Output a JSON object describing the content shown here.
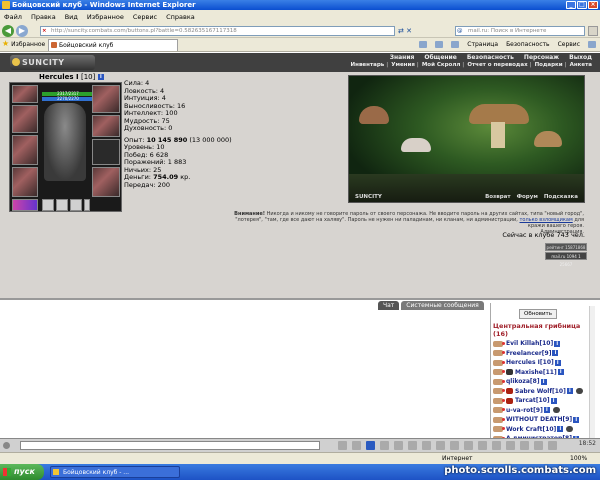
{
  "window": {
    "title": "Бойцовский клуб - Windows Internet Explorer"
  },
  "menu": [
    "Файл",
    "Правка",
    "Вид",
    "Избранное",
    "Сервис",
    "Справка"
  ],
  "address": {
    "url": "http://suncity.combats.com/buttons.pl?battle=0.582635167117318"
  },
  "search": {
    "placeholder": "mail.ru: Поиск в Интернете"
  },
  "favorites": {
    "label": "Избранное"
  },
  "tab": {
    "title": "Бойцовский клуб"
  },
  "ie_tools": [
    "Страница",
    "Безопасность",
    "Сервис"
  ],
  "game": {
    "logo": "SUNCITY",
    "nav_top": [
      "Знания",
      "Общение",
      "Безопасность",
      "Персонаж",
      "Выход"
    ],
    "nav_bottom": [
      "Инвентарь",
      "Умения",
      "Мой Скролл",
      "Отчет о переводах",
      "Подарки",
      "Анкета"
    ],
    "character": {
      "name": "Hercules I",
      "level": "[10]",
      "hp": "2317/2317",
      "mana": "2270/2270",
      "stats": [
        "Сила: 4",
        "Ловкость: 4",
        "Интуиция: 4",
        "Выносливость: 16",
        "Интеллект: 100",
        "Мудрость: 75",
        "Духовность: 0"
      ],
      "exp_label": "Опыт:",
      "exp_value": "10 145 890",
      "exp_next": "(13 000 000)",
      "details": [
        "Уровень: 10",
        "Побед: 6 628",
        "Поражений: 1 883",
        "Ничьих: 25"
      ],
      "money_label": "Деньги:",
      "money_value": "754.09",
      "money_unit": "кр.",
      "transfers": "Передач: 200"
    },
    "picture": {
      "caption": "SUNCITY",
      "links": [
        "Возврат",
        "Форум",
        "Подсказка"
      ]
    },
    "warning": {
      "bold": "Внимание!",
      "text1": "Никогда и никому не говорите пароль от своего персонажа. Не вводите пароль на других сайтах, типа \"новый город\", \"лотерея\", \"там, где все дают на халяву\". Пароль не нужен ни паладинам, ни кланам, ни администрации,",
      "link": "только взломщикам",
      "text2": "для кражи вашего героя.",
      "signature": "Администрация."
    },
    "online": "Сейчас в клубе 743 чел.",
    "counters": [
      "рейтинг 15871868",
      "mail.ru 1094 1 25667"
    ]
  },
  "chat": {
    "tabs": [
      "Чат",
      "Системные сообщения"
    ],
    "refresh": "Обновить",
    "room": "Центральная грибница",
    "room_count": "(16)",
    "users": [
      {
        "name": "Evil Killah",
        "level": "[10]"
      },
      {
        "name": "Freelancer",
        "level": "[9]"
      },
      {
        "name": "Hercules I",
        "level": "[10]"
      },
      {
        "name": "Maxishe",
        "level": "[11]"
      },
      {
        "name": "qlikoza",
        "level": "[8]"
      },
      {
        "name": "Sabre Wolf",
        "level": "[10]"
      },
      {
        "name": "Tarcat",
        "level": "[10]"
      },
      {
        "name": "u-va-rot",
        "level": "[9]"
      },
      {
        "name": "WITHOUT DEATH",
        "level": "[9]"
      },
      {
        "name": "Work Craft",
        "level": "[10]"
      },
      {
        "name": "А дминистратор",
        "level": "[8]"
      }
    ]
  },
  "toolbar": {
    "clock": "18:52"
  },
  "statusbar": {
    "zone": "Интернет",
    "zoom": "100%"
  },
  "taskbar": {
    "start": "пуск",
    "item": "Бойцовский клуб - ..."
  },
  "watermark": "photo.scrolls.combats.com"
}
